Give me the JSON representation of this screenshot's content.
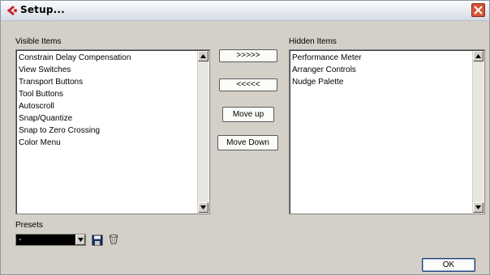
{
  "window": {
    "title": "Setup...",
    "close_icon": "close-icon",
    "app_icon": "cubase-logo-icon"
  },
  "visible": {
    "label": "Visible Items",
    "items": [
      "Constrain Delay Compensation",
      "View Switches",
      "Transport Buttons",
      "Tool Buttons",
      "Autoscroll",
      "Snap/Quantize",
      "Snap to Zero Crossing",
      "Color Menu"
    ]
  },
  "hidden": {
    "label": "Hidden Items",
    "items": [
      "Performance Meter",
      "Arranger Controls",
      "Nudge Palette"
    ]
  },
  "buttons": {
    "move_right": ">>>>>",
    "move_left": "<<<<<",
    "move_up": "Move up",
    "move_down": "Move Down",
    "ok": "OK"
  },
  "presets": {
    "label": "Presets",
    "value": "-",
    "save_icon": "save-disk-icon",
    "delete_icon": "trash-icon"
  },
  "colors": {
    "dialog_bg": "#d4d0c8",
    "close_red": "#d6543a",
    "combo_bg": "#000000"
  }
}
